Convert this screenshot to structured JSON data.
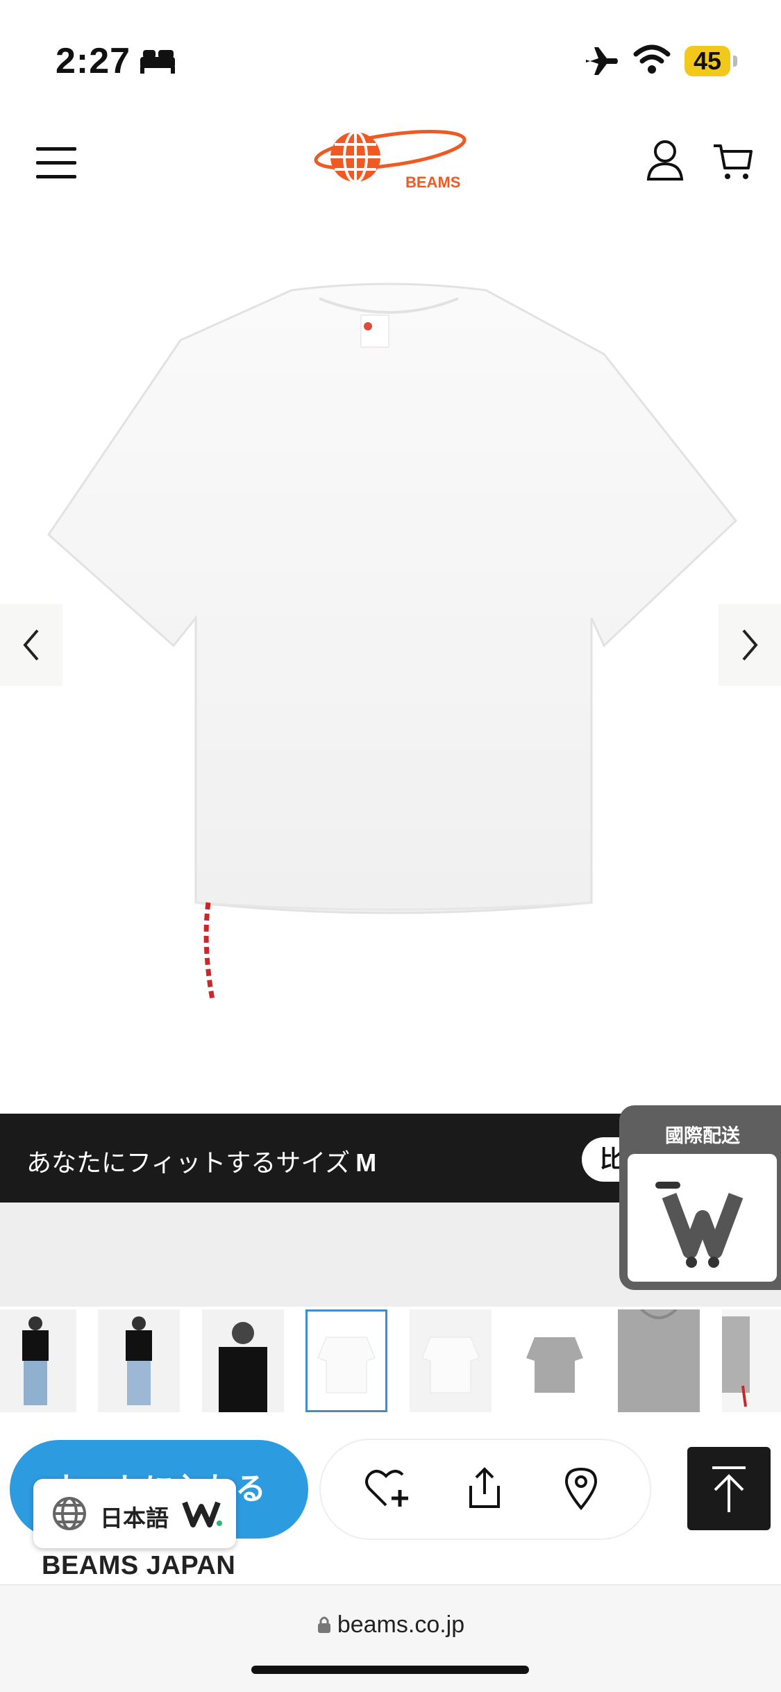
{
  "status_bar": {
    "time": "2:27",
    "battery": "45"
  },
  "header": {
    "logo_text": "BEAMS"
  },
  "fit_bar": {
    "text": "あなたにフィットするサイズ",
    "size": "M",
    "compare_label": "比"
  },
  "intl_shipping": {
    "title": "國際配送"
  },
  "action_bar": {
    "add_to_cart_label": "カートに入れる"
  },
  "language": {
    "label": "日本語"
  },
  "brand": {
    "name": "BEAMS JAPAN"
  },
  "browser": {
    "url": "beams.co.jp"
  },
  "colors": {
    "accent_blue": "#2d9be0",
    "brand_orange": "#f05a22",
    "dark_bar": "#1a1a1a"
  },
  "thumbnails": [
    {
      "label": "black-tee-model-front"
    },
    {
      "label": "black-tee-model-front-2"
    },
    {
      "label": "black-tee-model-closeup"
    },
    {
      "label": "white-tee-flat",
      "active": true
    },
    {
      "label": "white-tee-flat-back"
    },
    {
      "label": "grey-tee-flat"
    },
    {
      "label": "grey-tee-collar"
    },
    {
      "label": "grey-tee-detail"
    }
  ]
}
